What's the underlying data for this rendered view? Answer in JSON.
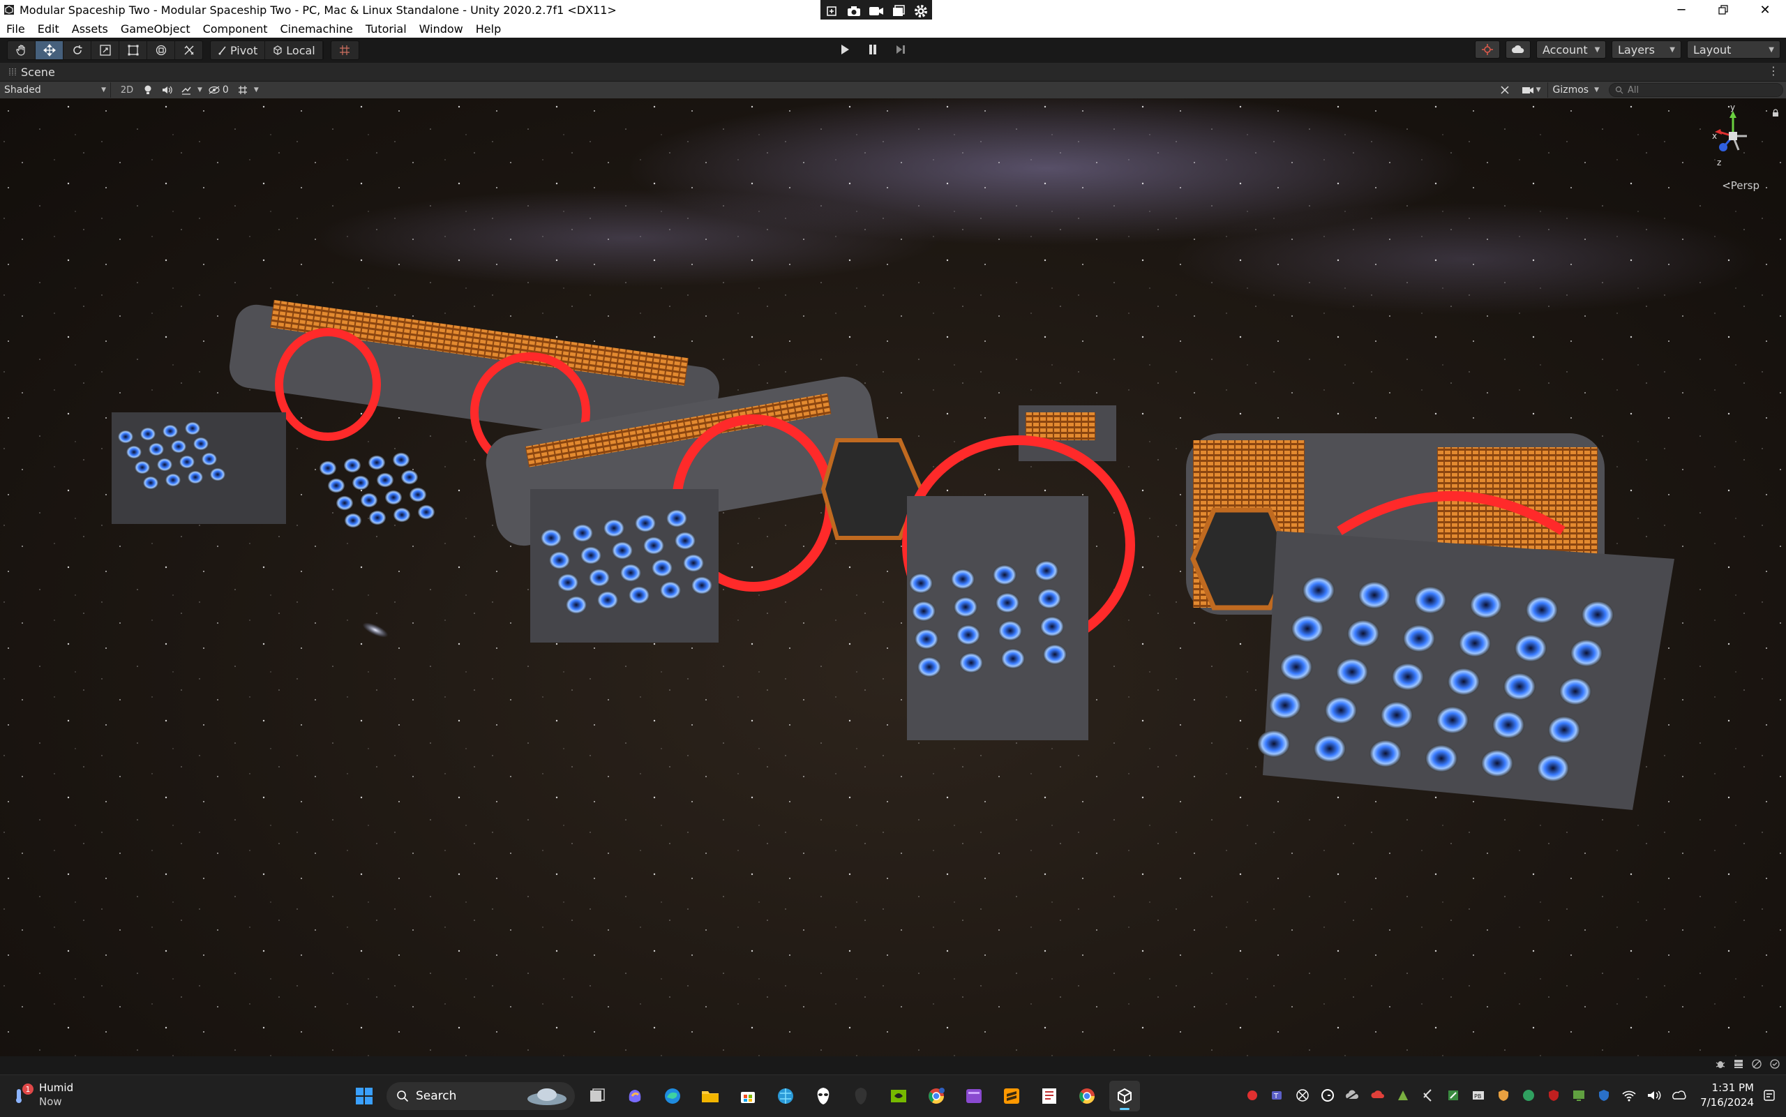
{
  "window": {
    "title": "Modular Spaceship Two - Modular Spaceship Two - PC, Mac & Linux Standalone - Unity 2020.2.7f1 <DX11>",
    "controls": [
      "minimize-icon",
      "maximize-icon",
      "close-icon"
    ]
  },
  "capture_bar": [
    "screenshot-icon",
    "camera-icon",
    "video-icon",
    "window-capture-icon",
    "settings-icon"
  ],
  "menu": [
    "File",
    "Edit",
    "Assets",
    "GameObject",
    "Component",
    "Cinemachine",
    "Tutorial",
    "Window",
    "Help"
  ],
  "toolbar": {
    "transform_tools": [
      "hand-tool-icon",
      "move-tool-icon",
      "rotate-tool-icon",
      "scale-tool-icon",
      "rect-tool-icon",
      "transform-tool-icon",
      "custom-tool-icon"
    ],
    "pivot_label": "Pivot",
    "local_label": "Local",
    "account_label": "Account",
    "layers_label": "Layers",
    "layout_label": "Layout"
  },
  "scene": {
    "tab_label": "Scene",
    "shading_mode": "Shaded",
    "mode_2d": "2D",
    "hidden_count": "0",
    "gizmos_label": "Gizmos",
    "search_placeholder": "All",
    "projection_label": "<Persp",
    "axis_labels": {
      "y": "y",
      "x": "x",
      "z": "z"
    }
  },
  "taskbar": {
    "weather_badge": "1",
    "weather_title": "Humid",
    "weather_subtitle": "Now",
    "search_label": "Search",
    "time": "1:31 PM",
    "date": "7/16/2024",
    "apps": [
      "windows-start-icon",
      "task-view-icon",
      "copilot-icon",
      "edge-icon",
      "file-explorer-icon",
      "store-icon",
      "browser-icon",
      "alienware-icon",
      "alien-dark-icon",
      "nvidia-icon",
      "chrome-profile-icon",
      "video-editor-icon",
      "sublime-icon",
      "snipping-icon",
      "chrome-icon",
      "unity-icon"
    ]
  },
  "colors": {
    "unity_active": "#46607c",
    "accent": "#60cdff",
    "engine_red": "#ff3030",
    "thruster_blue": "#3a7cff",
    "hull_orange": "#d6731f"
  }
}
